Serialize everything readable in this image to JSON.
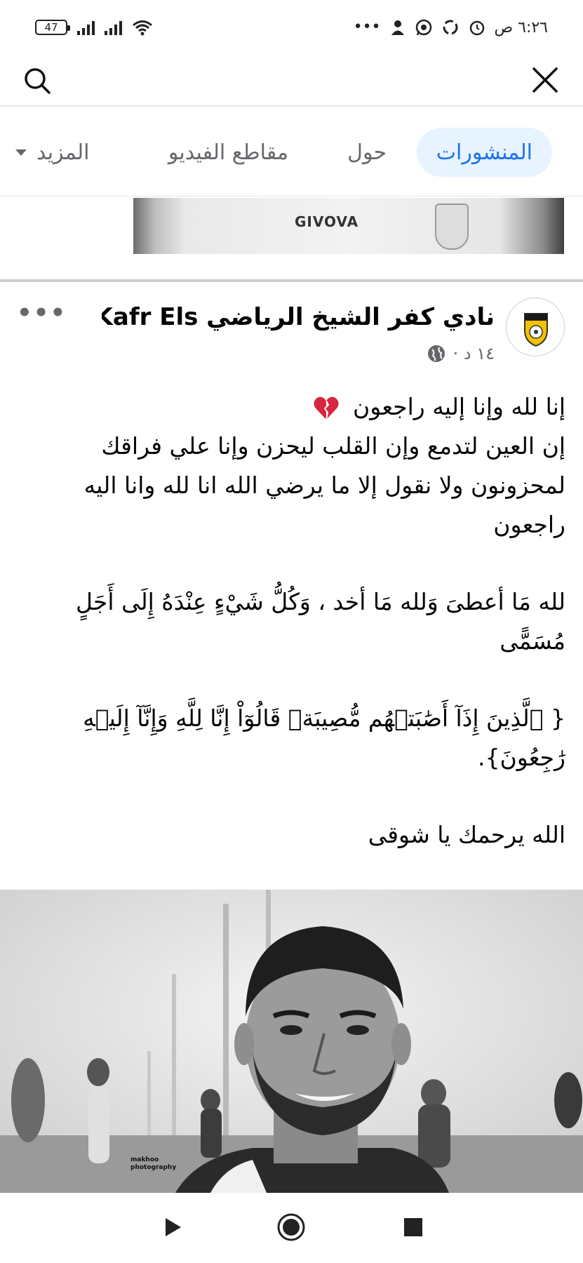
{
  "status_bar": {
    "time": "٦:٢٦ ص",
    "battery": "47",
    "icons": [
      "battery-icon",
      "signal-icon",
      "signal-icon",
      "wifi-icon",
      "more-dots-icon",
      "person-icon",
      "whatsapp-icon",
      "sync-icon",
      "alarm-icon"
    ]
  },
  "tabs": {
    "posts": "المنشورات",
    "about": "حول",
    "videos": "مقاطع الفيديو",
    "more": "المزيد"
  },
  "prev_post": {
    "brand_text": "GIVOVA"
  },
  "post": {
    "page_name": "نادي كفر الشيخ الرياضي  Kafr Els...",
    "time": "١٤ د ·",
    "more_label": "•••",
    "lines": [
      "إنا لله وإنا إليه راجعون",
      "إن العين لتدمع وإن القلب ليحزن وإنا علي فراقك لمحزونون ولا نقول إلا ما يرضي الله انا لله وانا اليه راجعون",
      "لله مَا أعطىَ وَلله مَا أخد ، وَكُلُّ شَيْءٍ عِنْدَهُ إِلَى أَجَلٍ مُسَمًّى",
      "{ ٱلَّذِينَ إِذَآ أَصَٰبَتۡهُم مُّصِيبَةٞ قَالُوٓاْ إِنَّا لِلَّهِ وَإِنَّآ إِلَيۡهِ رَٰجِعُونَ}.",
      "الله يرحمك يا شوقى"
    ]
  },
  "photo": {
    "watermark": "makhoo photography"
  },
  "colors": {
    "accent": "#1b74e4",
    "tab_bg": "#e7f3ff",
    "muted": "#65676b",
    "divider": "#c9ccd1"
  }
}
